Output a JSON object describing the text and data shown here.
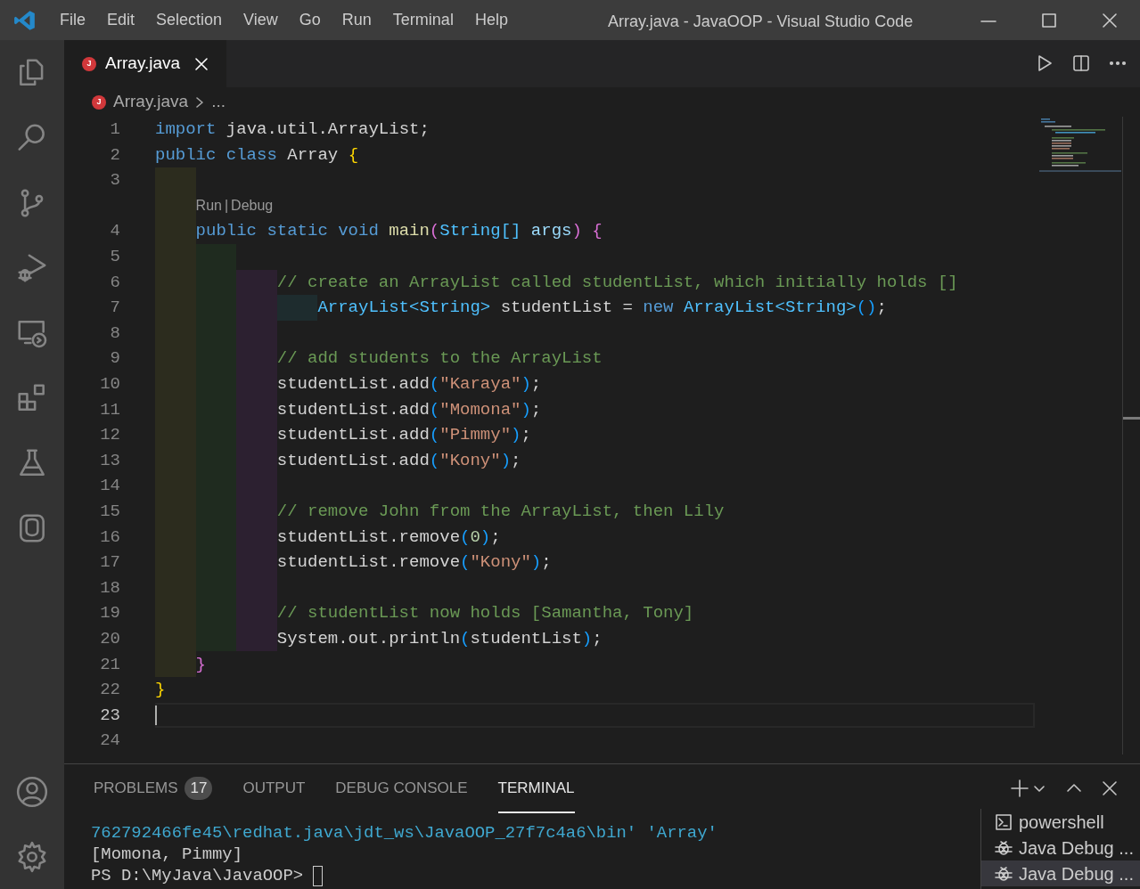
{
  "title_bar": {
    "menu": [
      "File",
      "Edit",
      "Selection",
      "View",
      "Go",
      "Run",
      "Terminal",
      "Help"
    ],
    "title": "Array.java - JavaOOP - Visual Studio Code"
  },
  "editor": {
    "tabs": [
      {
        "label": "Array.java",
        "badge": "J",
        "selected": true
      }
    ],
    "breadcrumb": {
      "badge": "J",
      "file": "Array.java",
      "rest": "..."
    },
    "lines": [
      {
        "number": "1",
        "current": false,
        "tokens": [
          {
            "kind": "kw",
            "text": "import"
          },
          {
            "kind": "plain",
            "text": " java.util.ArrayList;"
          }
        ]
      },
      {
        "number": "2",
        "current": false,
        "tokens": [
          {
            "kind": "kw",
            "text": "public class"
          },
          {
            "kind": "plain",
            "text": " Array "
          },
          {
            "kind": "b1",
            "text": "{"
          }
        ]
      },
      {
        "number": "3",
        "current": false
      },
      {
        "number": "4",
        "current": false,
        "codelens": {
          "links": [
            "Run",
            "Debug"
          ],
          "separator": "|"
        },
        "tokens": [
          {
            "kind": "kw",
            "text": "    public static void "
          },
          {
            "kind": "fn",
            "text": "main"
          },
          {
            "kind": "b2",
            "text": "("
          },
          {
            "kind": "type",
            "text": "String[]"
          },
          {
            "kind": "var",
            "text": " args"
          },
          {
            "kind": "b2",
            "text": ")"
          },
          {
            "kind": "b2",
            "text": " {"
          }
        ]
      },
      {
        "number": "5",
        "current": false
      },
      {
        "number": "6",
        "current": false,
        "tokens": [
          {
            "kind": "com",
            "text": "            // create an ArrayList called studentList, which initially holds []"
          }
        ]
      },
      {
        "number": "7",
        "current": false,
        "tokens": [
          {
            "kind": "type",
            "text": "                ArrayList<String>"
          },
          {
            "kind": "plain",
            "text": " studentList = "
          },
          {
            "kind": "kw",
            "text": "new "
          },
          {
            "kind": "type",
            "text": "ArrayList<String>"
          },
          {
            "kind": "b3",
            "text": "()"
          },
          {
            "kind": "plain",
            "text": ";"
          }
        ]
      },
      {
        "number": "8",
        "current": false
      },
      {
        "number": "9",
        "current": false,
        "tokens": [
          {
            "kind": "com",
            "text": "            // add students to the ArrayList"
          }
        ]
      },
      {
        "number": "10",
        "current": false,
        "tokens": [
          {
            "kind": "plain",
            "text": "            studentList.add"
          },
          {
            "kind": "b3",
            "text": "("
          },
          {
            "kind": "str",
            "text": "\"Karaya\""
          },
          {
            "kind": "b3",
            "text": ")"
          },
          {
            "kind": "plain",
            "text": ";"
          }
        ]
      },
      {
        "number": "11",
        "current": false,
        "tokens": [
          {
            "kind": "plain",
            "text": "            studentList.add"
          },
          {
            "kind": "b3",
            "text": "("
          },
          {
            "kind": "str",
            "text": "\"Momona\""
          },
          {
            "kind": "b3",
            "text": ")"
          },
          {
            "kind": "plain",
            "text": ";"
          }
        ]
      },
      {
        "number": "12",
        "current": false,
        "tokens": [
          {
            "kind": "plain",
            "text": "            studentList.add"
          },
          {
            "kind": "b3",
            "text": "("
          },
          {
            "kind": "str",
            "text": "\"Pimmy\""
          },
          {
            "kind": "b3",
            "text": ")"
          },
          {
            "kind": "plain",
            "text": ";"
          }
        ]
      },
      {
        "number": "13",
        "current": false,
        "tokens": [
          {
            "kind": "plain",
            "text": "            studentList.add"
          },
          {
            "kind": "b3",
            "text": "("
          },
          {
            "kind": "str",
            "text": "\"Kony\""
          },
          {
            "kind": "b3",
            "text": ")"
          },
          {
            "kind": "plain",
            "text": ";"
          }
        ]
      },
      {
        "number": "14",
        "current": false
      },
      {
        "number": "15",
        "current": false,
        "tokens": [
          {
            "kind": "com",
            "text": "            // remove John from the ArrayList, then Lily"
          }
        ]
      },
      {
        "number": "16",
        "current": false,
        "tokens": [
          {
            "kind": "plain",
            "text": "            studentList.remove"
          },
          {
            "kind": "b3",
            "text": "("
          },
          {
            "kind": "num",
            "text": "0"
          },
          {
            "kind": "b3",
            "text": ")"
          },
          {
            "kind": "plain",
            "text": ";"
          }
        ]
      },
      {
        "number": "17",
        "current": false,
        "tokens": [
          {
            "kind": "plain",
            "text": "            studentList.remove"
          },
          {
            "kind": "b3",
            "text": "("
          },
          {
            "kind": "str",
            "text": "\"Kony\""
          },
          {
            "kind": "b3",
            "text": ")"
          },
          {
            "kind": "plain",
            "text": ";"
          }
        ]
      },
      {
        "number": "18",
        "current": false
      },
      {
        "number": "19",
        "current": false,
        "tokens": [
          {
            "kind": "com",
            "text": "            // studentList now holds [Samantha, Tony]"
          }
        ]
      },
      {
        "number": "20",
        "current": false,
        "tokens": [
          {
            "kind": "plain",
            "text": "            System.out.println"
          },
          {
            "kind": "b3",
            "text": "("
          },
          {
            "kind": "plain",
            "text": "studentList"
          },
          {
            "kind": "b3",
            "text": ")"
          },
          {
            "kind": "plain",
            "text": ";"
          }
        ]
      },
      {
        "number": "21",
        "current": false,
        "tokens": [
          {
            "kind": "b2",
            "text": "    }"
          }
        ]
      },
      {
        "number": "22",
        "current": false,
        "tokens": [
          {
            "kind": "b1",
            "text": "}"
          }
        ]
      },
      {
        "number": "23",
        "current": true
      },
      {
        "number": "24",
        "current": false
      }
    ]
  },
  "panel": {
    "tabs": [
      {
        "label": "PROBLEMS",
        "badge": "17",
        "selected": false
      },
      {
        "label": "OUTPUT",
        "selected": false
      },
      {
        "label": "DEBUG CONSOLE",
        "selected": false
      },
      {
        "label": "TERMINAL",
        "selected": true
      }
    ],
    "terminal": {
      "lines": [
        {
          "kind": "path",
          "text": "762792466fe45\\redhat.java\\jdt_ws\\JavaOOP_27f7c4a6\\bin' 'Array'"
        },
        {
          "kind": "output",
          "text": "[Momona, Pimmy]"
        },
        {
          "kind": "prompt",
          "text": "PS D:\\MyJava\\JavaOOP>"
        }
      ],
      "sessions": [
        {
          "kind": "shell",
          "label": "powershell",
          "selected": false
        },
        {
          "kind": "debug",
          "label": "Java Debug ...",
          "selected": false
        },
        {
          "kind": "debug",
          "label": "Java Debug ...",
          "selected": true
        }
      ]
    }
  }
}
